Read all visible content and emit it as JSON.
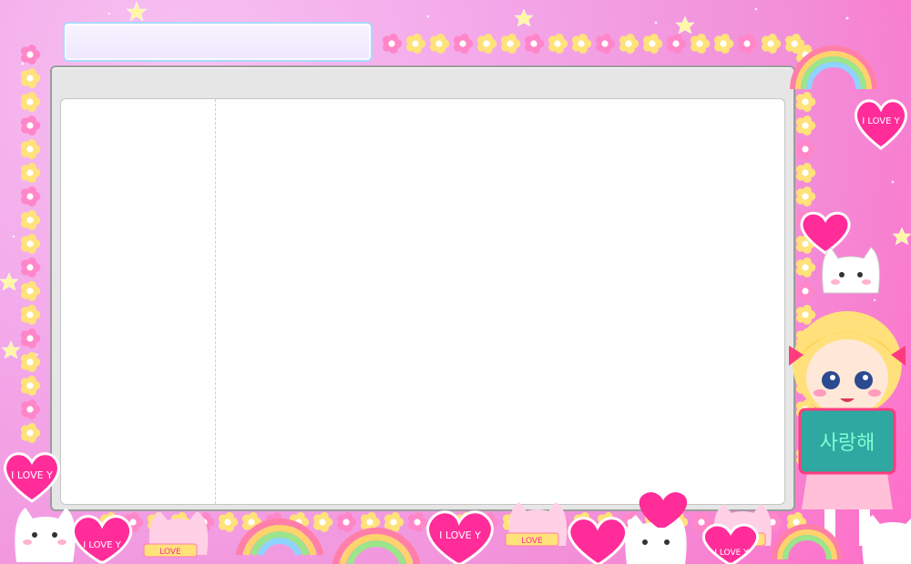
{
  "window": {
    "title": "",
    "sidebar_items": [],
    "content_text": ""
  },
  "decorations": {
    "heart_text": "I LOVE Y",
    "sign_text": "사랑해",
    "cat_banner_text": "LOVE",
    "colors": {
      "background": "#f3a8ea",
      "accent_pink": "#ff2c9a",
      "flower_pink": "#ff86c8",
      "flower_yellow": "#ffe27a",
      "window_frame": "#e6e6e6",
      "window_border": "#9c9c9c",
      "title_bar_border": "#a9d8ff"
    }
  }
}
